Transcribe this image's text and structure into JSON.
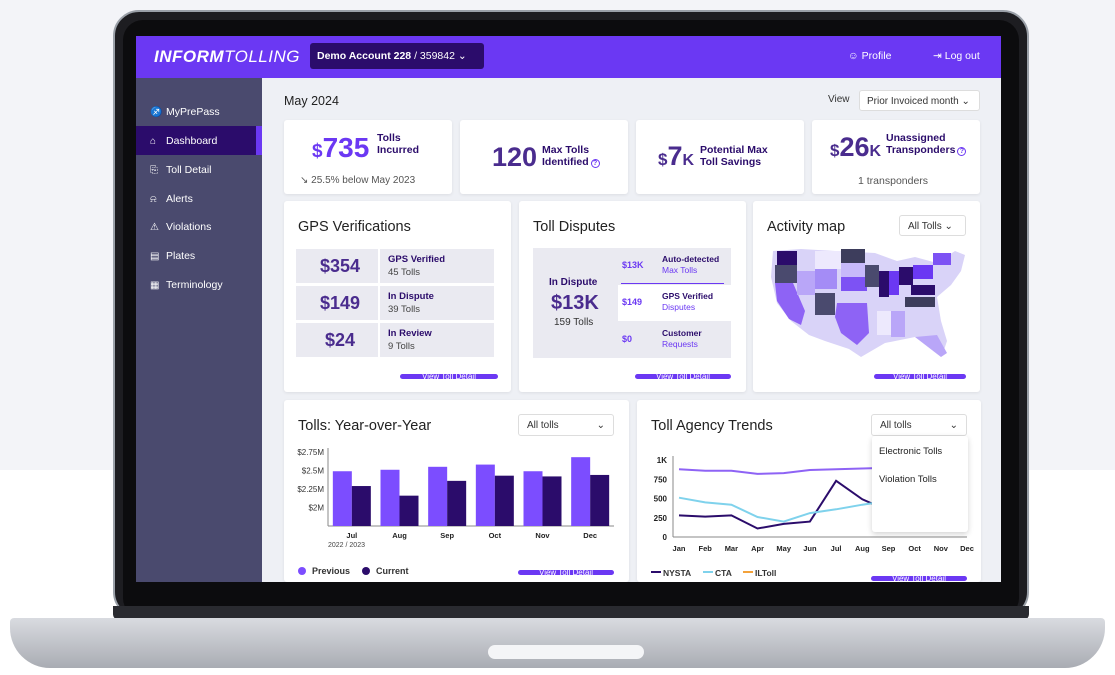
{
  "colors": {
    "brand": "#6b38f3",
    "dark": "#2b0c6b",
    "sidebar": "#4a4a6e",
    "cta": "#7fd2ec",
    "iltoll": "#f3a23b"
  },
  "app": {
    "logo_main": "INFORM",
    "logo_thin": "TOLLING",
    "account_name": "Demo Account 228",
    "account_sep": "/",
    "account_id": "359842",
    "profile": "Profile",
    "logout": "Log out"
  },
  "sidebar": {
    "items": [
      {
        "label": "MyPrePass",
        "icon": "car-icon"
      },
      {
        "label": "Dashboard",
        "icon": "home-icon"
      },
      {
        "label": "Toll Detail",
        "icon": "receipt-icon"
      },
      {
        "label": "Alerts",
        "icon": "bell-icon"
      },
      {
        "label": "Violations",
        "icon": "warning-icon"
      },
      {
        "label": "Plates",
        "icon": "plate-icon"
      },
      {
        "label": "Terminology",
        "icon": "book-icon"
      }
    ]
  },
  "header": {
    "period": "May 2024",
    "view_label": "View",
    "view_value": "Prior Invoiced month"
  },
  "kpis": [
    {
      "prefix": "$",
      "value": "735",
      "label1": "Tolls",
      "label2": "Incurred",
      "sub": "25.5% below May 2023"
    },
    {
      "prefix": "",
      "value": "120",
      "label1": "Max Tolls",
      "label2": "Identified"
    },
    {
      "prefix": "$",
      "value": "7",
      "suffix": "K",
      "label1": "Potential Max",
      "label2": "Toll Savings"
    },
    {
      "prefix": "$",
      "value": "26",
      "suffix": "K",
      "label1": "Unassigned",
      "label2": "Transponders",
      "sub": "1 transponders"
    }
  ],
  "gps": {
    "title": "GPS Verifications",
    "rows": [
      {
        "value": "$354",
        "title": "GPS Verified",
        "sub": "45 Tolls"
      },
      {
        "value": "$149",
        "title": "In Dispute",
        "sub": "39 Tolls"
      },
      {
        "value": "$24",
        "title": "In Review",
        "sub": "9 Tolls"
      }
    ],
    "link": "View Toll Detail"
  },
  "disputes": {
    "title": "Toll Disputes",
    "in_label": "In Dispute",
    "in_value": "$13K",
    "in_sub": "159 Tolls",
    "rows": [
      {
        "amount": "$13K",
        "title": "Auto-detected",
        "sub": "Max Tolls"
      },
      {
        "amount": "$149",
        "title": "GPS Verified",
        "sub": "Disputes"
      },
      {
        "amount": "$0",
        "title": "Customer",
        "sub": "Requests"
      }
    ],
    "link": "View Toll Detail"
  },
  "map": {
    "title": "Activity map",
    "filter": "All Tolls",
    "link": "View Toll Detail"
  },
  "yoy": {
    "title": "Tolls: Year-over-Year",
    "filter": "All tolls",
    "years": "2022 / 2023",
    "legend_prev": "Previous",
    "legend_curr": "Current",
    "link": "View Toll Detail"
  },
  "trends": {
    "title": "Toll Agency Trends",
    "filter": "All tolls",
    "dropdown": [
      "Electronic Tolls",
      "Violation Tolls"
    ],
    "link": "View Toll Detail"
  },
  "chart_data": [
    {
      "type": "bar",
      "title": "Tolls: Year-over-Year",
      "categories": [
        "Jul",
        "Aug",
        "Sep",
        "Oct",
        "Nov",
        "Dec"
      ],
      "ylim": [
        1.75,
        2.75
      ],
      "yticks": [
        "$2.75M",
        "$2.5M",
        "$2.25M",
        "$2M"
      ],
      "series": [
        {
          "name": "Previous",
          "values": [
            2.49,
            2.51,
            2.55,
            2.58,
            2.49,
            2.68
          ]
        },
        {
          "name": "Current",
          "values": [
            2.29,
            2.16,
            2.36,
            2.43,
            2.42,
            2.44
          ]
        }
      ]
    },
    {
      "type": "line",
      "title": "Toll Agency Trends",
      "categories": [
        "Jan",
        "Feb",
        "Mar",
        "Apr",
        "May",
        "Jun",
        "Jul",
        "Aug",
        "Sep",
        "Oct",
        "Nov",
        "Dec"
      ],
      "ylim": [
        0,
        1000
      ],
      "yticks": [
        "1K",
        "750",
        "500",
        "250",
        "0"
      ],
      "series": [
        {
          "name": "NYSTA",
          "values": [
            280,
            265,
            280,
            110,
            170,
            200,
            730,
            490,
            340,
            400,
            460,
            520
          ]
        },
        {
          "name": "CTA",
          "values": [
            510,
            450,
            420,
            260,
            200,
            310,
            360,
            420,
            470,
            500,
            540,
            580
          ]
        },
        {
          "name": "ILToll",
          "values": [
            880,
            860,
            860,
            820,
            830,
            870,
            880,
            890,
            900,
            900,
            900,
            900
          ]
        }
      ]
    }
  ]
}
